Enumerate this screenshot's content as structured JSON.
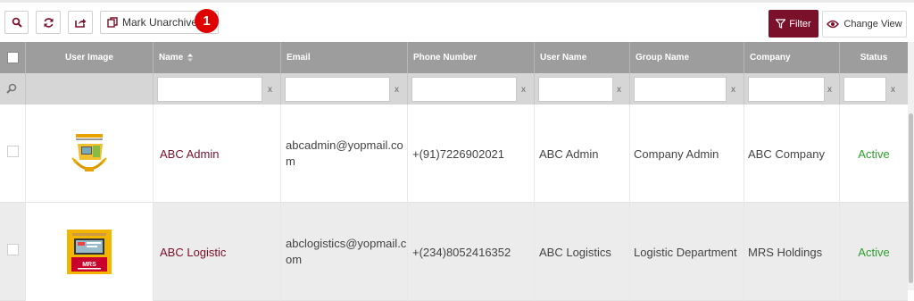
{
  "toolbar": {
    "mark_unarchive_label": "Mark Unarchive",
    "selected_count": "1",
    "filter_label": "Filter",
    "change_view_label": "Change View"
  },
  "columns": {
    "user_image": "User Image",
    "name": "Name",
    "email": "Email",
    "phone": "Phone Number",
    "username": "User Name",
    "group": "Group Name",
    "company": "Company",
    "status": "Status"
  },
  "filter_clear": "x",
  "rows": [
    {
      "name": "ABC Admin",
      "email_line1": "abcadmin@yopmail.co",
      "email_line2": "m",
      "phone": "+(91)7226902021",
      "username": "ABC Admin",
      "group": "Company Admin",
      "company": "ABC Company",
      "status": "Active",
      "image": "portal-logo-icon"
    },
    {
      "name": "ABC Logistic",
      "email_line1": "abclogistics@yopmail.c",
      "email_line2": "om",
      "phone": "+(234)8052416352",
      "username": "ABC Logistics",
      "group": "Logistic Department",
      "company": "MRS Holdings",
      "status": "Active",
      "image": "mrs-logo-icon"
    }
  ],
  "colors": {
    "accent": "#7a1029",
    "header_bg": "#9d9d9d",
    "filter_row_bg": "#d6d6d6",
    "row_alt_bg": "#ececec",
    "status_active": "#2ea02e",
    "badge": "#e00000"
  }
}
